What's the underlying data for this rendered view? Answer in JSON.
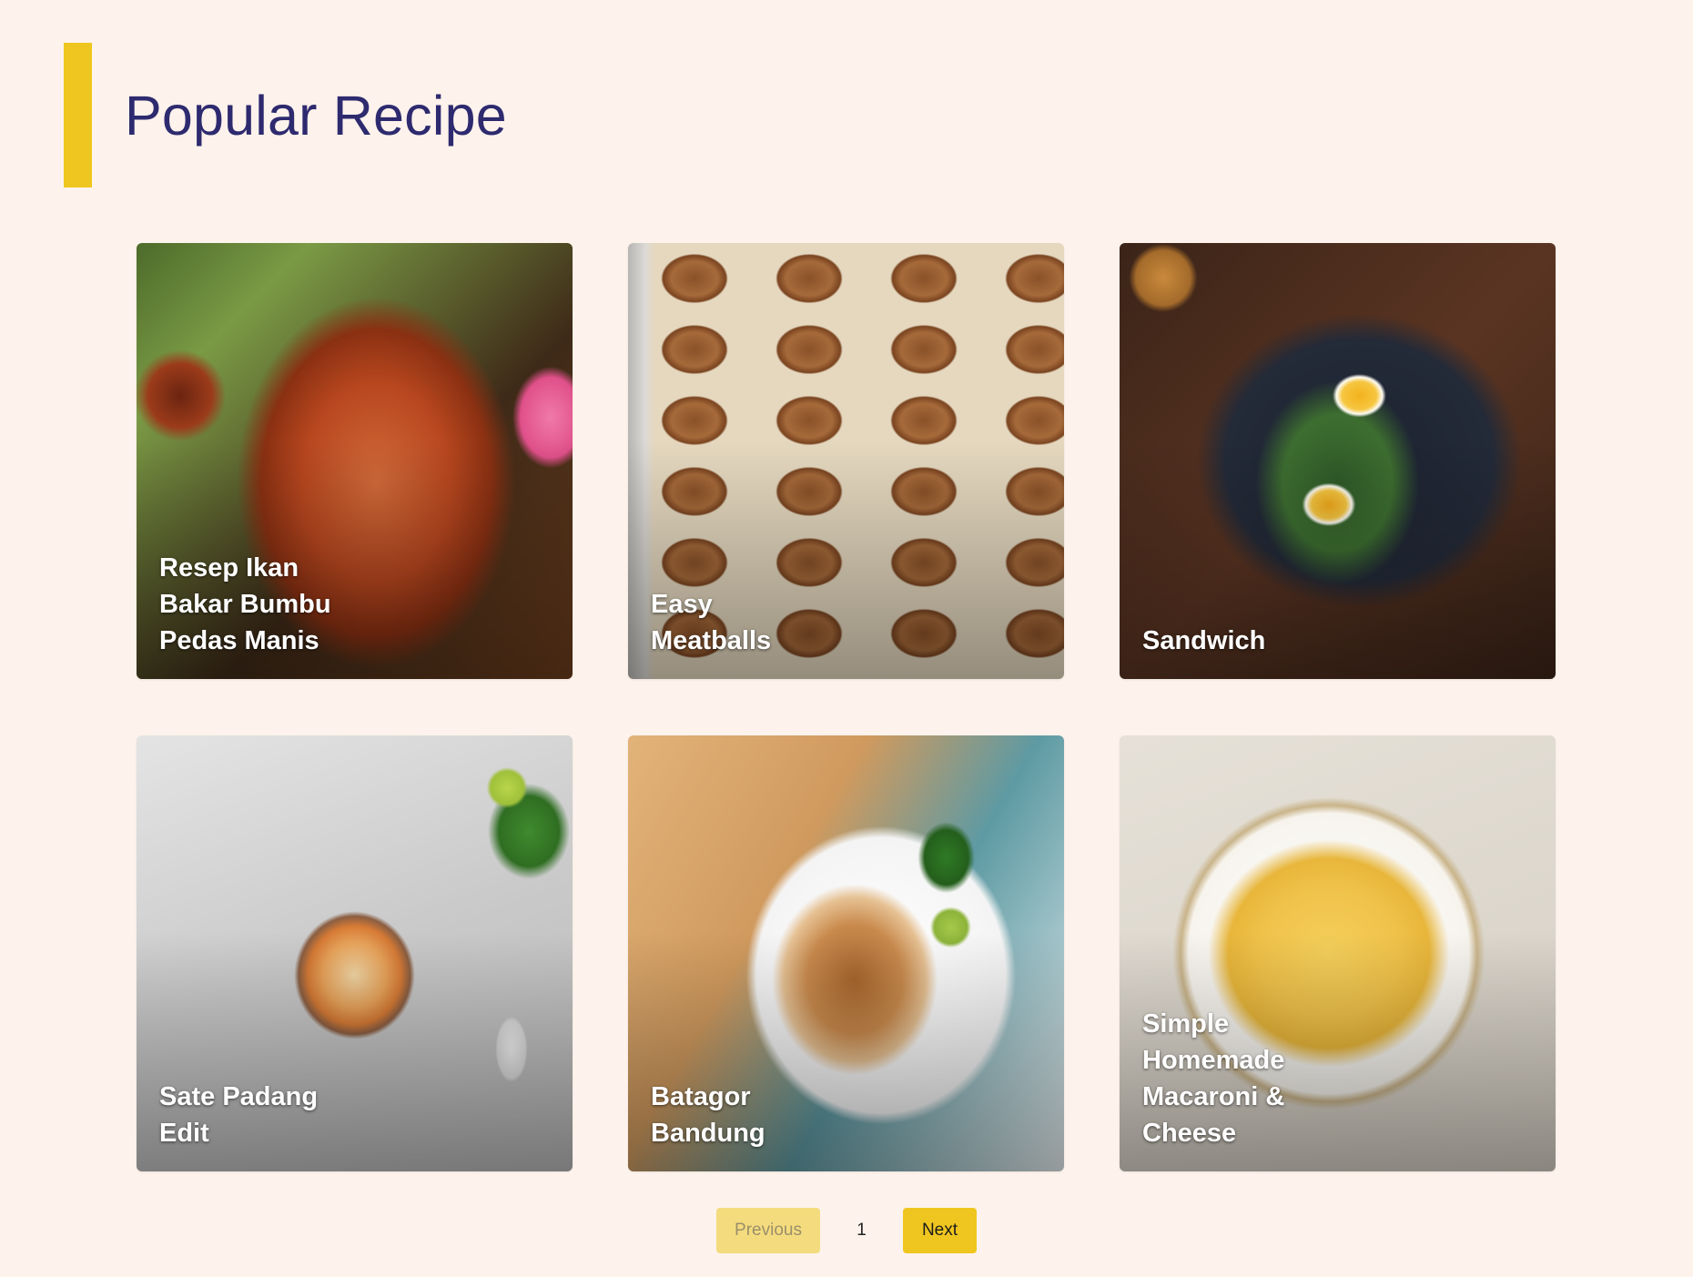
{
  "header": {
    "title": "Popular Recipe",
    "accent_color": "#efc61f",
    "title_color": "#2e2a6f"
  },
  "recipes": [
    {
      "title": "Resep Ikan Bakar Bumbu Pedas Manis",
      "image": "grilled-fish-photo"
    },
    {
      "title": "Easy Meatballs",
      "image": "meatballs-tray-photo"
    },
    {
      "title": "Sandwich",
      "image": "egg-avocado-toast-photo"
    },
    {
      "title": "Sate Padang Edit",
      "image": "noodle-soup-bowl-photo"
    },
    {
      "title": "Batagor Bandung",
      "image": "batagor-plate-photo"
    },
    {
      "title": "Simple Homemade Macaroni & Cheese",
      "image": "mac-and-cheese-bowl-photo"
    }
  ],
  "pagination": {
    "previous_label": "Previous",
    "current_page": "1",
    "next_label": "Next"
  },
  "colors": {
    "background": "#fdf3ec",
    "button_active": "#efc61f",
    "button_disabled": "#f4dc7e"
  }
}
